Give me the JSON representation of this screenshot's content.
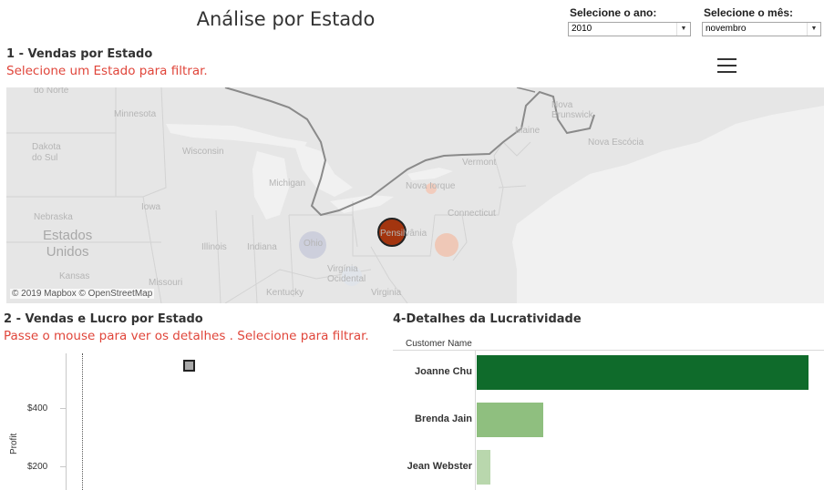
{
  "dashboard": {
    "title": "Análise por Estado"
  },
  "filters": {
    "year": {
      "label": "Selecione o ano:",
      "value": "2010"
    },
    "month": {
      "label": "Selecione o mês:",
      "value": "novembro"
    }
  },
  "map_sheet": {
    "title": "1 - Vendas por Estado",
    "subtitle": "Selecione um Estado para filtrar.",
    "attribution": "© 2019 Mapbox © OpenStreetMap",
    "labels": {
      "do_norte": "do Norte",
      "minnesota": "Minnesota",
      "dakota_do_sul": "Dakota\ndo Sul",
      "wisconsin": "Wisconsin",
      "michigan": "Michigan",
      "iowa": "Iowa",
      "nebraska": "Nebraska",
      "estados_unidos": "Estados\nUnidos",
      "kansas": "Kansas",
      "missouri": "Missouri",
      "illinois": "Illinois",
      "indiana": "Indiana",
      "ohio": "Ohio",
      "kentucky": "Kentucky",
      "virginia": "Virginia",
      "virginia_ocidental": "Virgínia\nOcidental",
      "nova_iorque": "Nova Iorque",
      "vermont": "Vermont",
      "maine": "Maine",
      "nova_brunswick": "Nova\nBrunswick",
      "nova_escocia": "Nova Escócia",
      "connecticut": "Connecticut",
      "pensilvania": "Pensilvânia"
    }
  },
  "scatter_sheet": {
    "title": "2 - Vendas e Lucro por Estado",
    "subtitle": "Passe o mouse para ver os detalhes . Selecione para filtrar.",
    "y_axis_title": "Profit",
    "ticks": [
      "$400",
      "$200"
    ]
  },
  "bar_sheet": {
    "title": "4-Detalhes da Lucratividade",
    "column_header": "Customer Name"
  },
  "chart_data": {
    "type": "bar",
    "orientation": "horizontal",
    "categories": [
      "Joanne Chu",
      "Brenda Jain",
      "Jean Webster"
    ],
    "values": [
      100,
      20,
      4
    ],
    "colors": [
      "#0f6b2b",
      "#8fbf7f",
      "#b9d7ad"
    ]
  }
}
